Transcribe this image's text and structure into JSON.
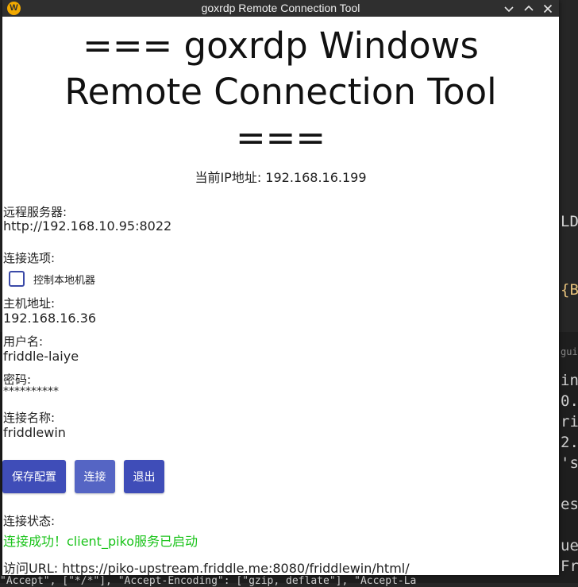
{
  "window": {
    "title": "goxrdp Remote Connection Tool",
    "app_icon_glyph": "W"
  },
  "heading": {
    "line1": "=== goxrdp Windows",
    "line2": "Remote Connection Tool",
    "line3": "==="
  },
  "ip": {
    "text": "当前IP地址: 192.168.16.199"
  },
  "server": {
    "label": "远程服务器:",
    "value": "http://192.168.10.95:8022"
  },
  "options": {
    "label": "连接选项:",
    "control_local_label": "控制本地机器",
    "control_local_checked": false
  },
  "host": {
    "label": "主机地址:",
    "value": "192.168.16.36"
  },
  "username": {
    "label": "用户名:",
    "value": "friddle-laiye"
  },
  "password": {
    "label": "密码:",
    "value": "**********"
  },
  "connection_name": {
    "label": "连接名称:",
    "value": "friddlewin"
  },
  "buttons": {
    "save": "保存配置",
    "connect": "连接",
    "exit": "退出"
  },
  "status": {
    "label": "连接状态:",
    "text": "连接成功！client_piko服务已启动",
    "color": "#19c319"
  },
  "access": {
    "text": "访问URL: https://piko-upstream.friddle.me:8080/friddlewin/html/"
  },
  "background_editor": {
    "fragments": [
      "LD",
      "{B",
      "gui",
      "in/",
      "0.0",
      "ri\"",
      "2.1",
      "'st",
      "est",
      "ues",
      "Fri",
      "\"Accept\", [\"*/*\"], \"Accept-Encoding\": [\"gzip, deflate\"], \"Accept-La"
    ]
  }
}
